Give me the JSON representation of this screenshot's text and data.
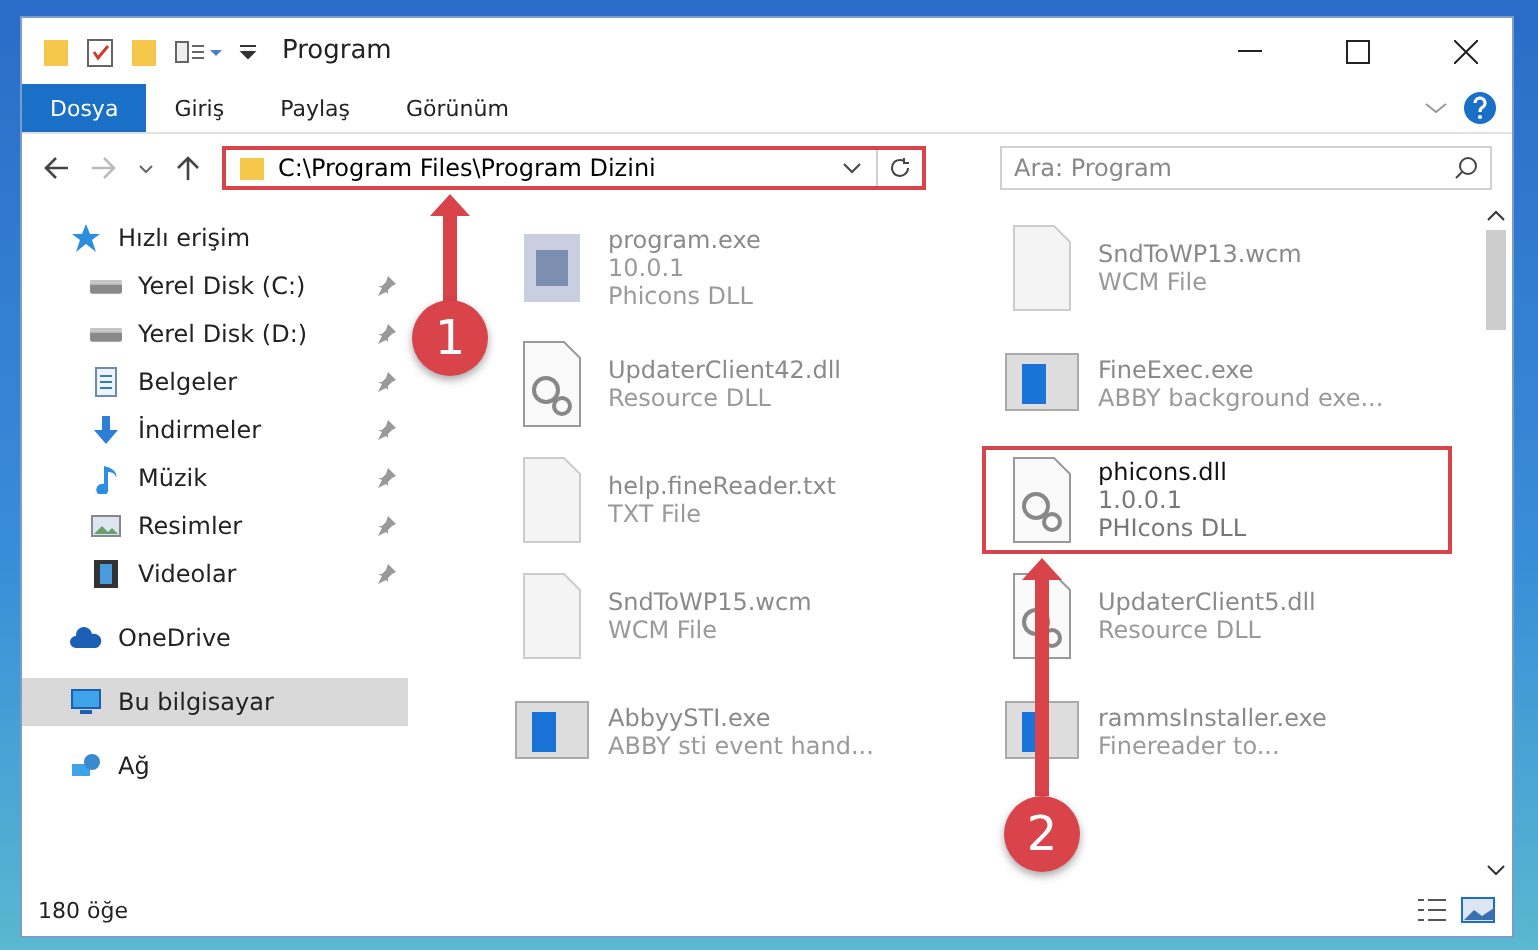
{
  "window": {
    "title": "Program"
  },
  "ribbon_tabs": [
    {
      "label": "Dosya",
      "selected": true
    },
    {
      "label": "Giriş",
      "selected": false
    },
    {
      "label": "Paylaş",
      "selected": false
    },
    {
      "label": "Görünüm",
      "selected": false
    }
  ],
  "address_bar": {
    "path": "C:\\Program Files\\Program Dizini",
    "highlighted": true
  },
  "search": {
    "placeholder": "Ara: Program"
  },
  "sidebar": {
    "items": [
      {
        "label": "Hızlı erişim",
        "kind": "star",
        "pinned": false,
        "selected": false,
        "children": [
          {
            "label": "Yerel Disk (C:)",
            "kind": "disk",
            "pinned": true,
            "selected": false
          },
          {
            "label": "Yerel Disk (D:)",
            "kind": "disk",
            "pinned": true,
            "selected": false
          },
          {
            "label": "Belgeler",
            "kind": "doc",
            "pinned": true,
            "selected": false
          },
          {
            "label": "İndirmeler",
            "kind": "download",
            "pinned": true,
            "selected": false
          },
          {
            "label": "Müzik",
            "kind": "music",
            "pinned": true,
            "selected": false
          },
          {
            "label": "Resimler",
            "kind": "picture",
            "pinned": true,
            "selected": false
          },
          {
            "label": "Videolar",
            "kind": "video",
            "pinned": true,
            "selected": false
          }
        ]
      },
      {
        "label": "OneDrive",
        "kind": "cloud",
        "pinned": false,
        "selected": false
      },
      {
        "label": "Bu bilgisayar",
        "kind": "pc",
        "pinned": false,
        "selected": true
      },
      {
        "label": "Ağ",
        "kind": "network",
        "pinned": false,
        "selected": false
      }
    ]
  },
  "files": [
    {
      "name": "program.exe",
      "lines": [
        "10.0.1",
        "Phicons DLL"
      ],
      "kind": "exe",
      "blurred": true,
      "highlighted": false
    },
    {
      "name": "SndToWP13.wcm",
      "lines": [
        "WCM File"
      ],
      "kind": "blank",
      "blurred": true,
      "highlighted": false
    },
    {
      "name": "UpdaterClient42.dll",
      "lines": [
        "Resource DLL"
      ],
      "kind": "dll",
      "blurred": true,
      "highlighted": false
    },
    {
      "name": "FineExec.exe",
      "lines": [
        "ABBY background exe..."
      ],
      "kind": "app",
      "blurred": true,
      "highlighted": false
    },
    {
      "name": "help.fineReader.txt",
      "lines": [
        "TXT File"
      ],
      "kind": "blank",
      "blurred": true,
      "highlighted": false
    },
    {
      "name": "phicons.dll",
      "lines": [
        "1.0.0.1",
        "PHIcons DLL"
      ],
      "kind": "dll",
      "blurred": false,
      "highlighted": true
    },
    {
      "name": "SndToWP15.wcm",
      "lines": [
        "WCM File"
      ],
      "kind": "blank",
      "blurred": true,
      "highlighted": false
    },
    {
      "name": "UpdaterClient5.dll",
      "lines": [
        "Resource DLL"
      ],
      "kind": "dll",
      "blurred": true,
      "highlighted": false
    },
    {
      "name": "AbbyySTI.exe",
      "lines": [
        "ABBY sti event hand..."
      ],
      "kind": "app",
      "blurred": true,
      "highlighted": false
    },
    {
      "name": "rammsInstaller.exe",
      "lines": [
        "Finereader to..."
      ],
      "kind": "app",
      "blurred": true,
      "highlighted": false
    }
  ],
  "status_bar": {
    "count": "180 öğe"
  },
  "annotations": [
    {
      "number": "1"
    },
    {
      "number": "2"
    }
  ]
}
